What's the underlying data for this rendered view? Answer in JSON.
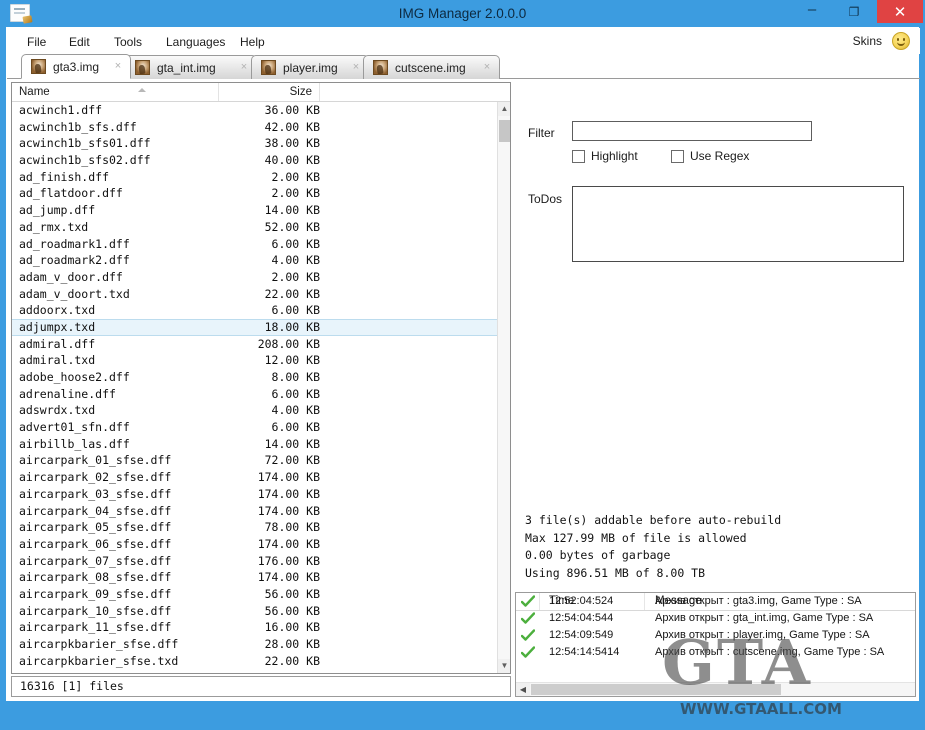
{
  "window": {
    "title": "IMG Manager 2.0.0.0",
    "app_icon": "document-pen-icon",
    "minimize_label": "–",
    "maximize_label": "❐",
    "close_label": "✕",
    "accent_color": "#3c9ce0",
    "close_color": "#e04343"
  },
  "menubar": {
    "items": [
      {
        "label": "File"
      },
      {
        "label": "Edit"
      },
      {
        "label": "Tools"
      },
      {
        "label": "Languages"
      },
      {
        "label": "Help"
      }
    ],
    "skins_label": "Skins",
    "smiley_icon": "smiley-face-icon"
  },
  "tabs": [
    {
      "label": "gta3.img",
      "active": true,
      "close_label": "×"
    },
    {
      "label": "gta_int.img",
      "active": false,
      "close_label": "×"
    },
    {
      "label": "player.img",
      "active": false,
      "close_label": "×"
    },
    {
      "label": "cutscene.img",
      "active": false,
      "close_label": "×"
    }
  ],
  "filelist": {
    "columns": {
      "name": "Name",
      "size": "Size"
    },
    "sort": "ascending",
    "selected_index": 13,
    "rows": [
      {
        "name": "acwinch1.dff",
        "size": "36.00 KB"
      },
      {
        "name": "acwinch1b_sfs.dff",
        "size": "42.00 KB"
      },
      {
        "name": "acwinch1b_sfs01.dff",
        "size": "38.00 KB"
      },
      {
        "name": "acwinch1b_sfs02.dff",
        "size": "40.00 KB"
      },
      {
        "name": "ad_finish.dff",
        "size": "2.00 KB"
      },
      {
        "name": "ad_flatdoor.dff",
        "size": "2.00 KB"
      },
      {
        "name": "ad_jump.dff",
        "size": "14.00 KB"
      },
      {
        "name": "ad_rmx.txd",
        "size": "52.00 KB"
      },
      {
        "name": "ad_roadmark1.dff",
        "size": "6.00 KB"
      },
      {
        "name": "ad_roadmark2.dff",
        "size": "4.00 KB"
      },
      {
        "name": "adam_v_door.dff",
        "size": "2.00 KB"
      },
      {
        "name": "adam_v_doort.txd",
        "size": "22.00 KB"
      },
      {
        "name": "addoorx.txd",
        "size": "6.00 KB"
      },
      {
        "name": "adjumpx.txd",
        "size": "18.00 KB"
      },
      {
        "name": "admiral.dff",
        "size": "208.00 KB"
      },
      {
        "name": "admiral.txd",
        "size": "12.00 KB"
      },
      {
        "name": "adobe_hoose2.dff",
        "size": "8.00 KB"
      },
      {
        "name": "adrenaline.dff",
        "size": "6.00 KB"
      },
      {
        "name": "adswrdx.txd",
        "size": "4.00 KB"
      },
      {
        "name": "advert01_sfn.dff",
        "size": "6.00 KB"
      },
      {
        "name": "airbillb_las.dff",
        "size": "14.00 KB"
      },
      {
        "name": "aircarpark_01_sfse.dff",
        "size": "72.00 KB"
      },
      {
        "name": "aircarpark_02_sfse.dff",
        "size": "174.00 KB"
      },
      {
        "name": "aircarpark_03_sfse.dff",
        "size": "174.00 KB"
      },
      {
        "name": "aircarpark_04_sfse.dff",
        "size": "174.00 KB"
      },
      {
        "name": "aircarpark_05_sfse.dff",
        "size": "78.00 KB"
      },
      {
        "name": "aircarpark_06_sfse.dff",
        "size": "174.00 KB"
      },
      {
        "name": "aircarpark_07_sfse.dff",
        "size": "176.00 KB"
      },
      {
        "name": "aircarpark_08_sfse.dff",
        "size": "174.00 KB"
      },
      {
        "name": "aircarpark_09_sfse.dff",
        "size": "56.00 KB"
      },
      {
        "name": "aircarpark_10_sfse.dff",
        "size": "56.00 KB"
      },
      {
        "name": "aircarpark_11_sfse.dff",
        "size": "16.00 KB"
      },
      {
        "name": "aircarpkbarier_sfse.dff",
        "size": "28.00 KB"
      },
      {
        "name": "aircarpkbarier_sfse.txd",
        "size": "22.00 KB"
      }
    ]
  },
  "statusbar": {
    "text": "16316 [1] files"
  },
  "filter": {
    "label": "Filter",
    "value": "",
    "placeholder": "",
    "highlight_label": "Highlight",
    "highlight_checked": false,
    "regex_label": "Use Regex",
    "regex_checked": false
  },
  "todos": {
    "label": "ToDos",
    "value": "",
    "placeholder": ""
  },
  "archive_info": {
    "lines": [
      "3 file(s) addable before auto-rebuild",
      "Max 127.99 MB of file is allowed",
      "0.00 bytes of garbage",
      "Using 896.51 MB of 8.00 TB"
    ]
  },
  "log": {
    "columns": {
      "time": "Time",
      "message": "Message"
    },
    "rows": [
      {
        "status": "ok-check-icon",
        "time": "12:52:04:524",
        "message": "Архив открыт : gta3.img, Game Type : SA"
      },
      {
        "status": "ok-check-icon",
        "time": "12:54:04:544",
        "message": "Архив открыт : gta_int.img, Game Type : SA"
      },
      {
        "status": "ok-check-icon",
        "time": "12:54:09:549",
        "message": "Архив открыт : player.img, Game Type : SA"
      },
      {
        "status": "ok-check-icon",
        "time": "12:54:14:5414",
        "message": "Архив открыт : cutscene.img, Game Type : SA"
      }
    ]
  },
  "watermark": {
    "logo": "GTA",
    "url": "WWW.GTAALL.COM"
  }
}
